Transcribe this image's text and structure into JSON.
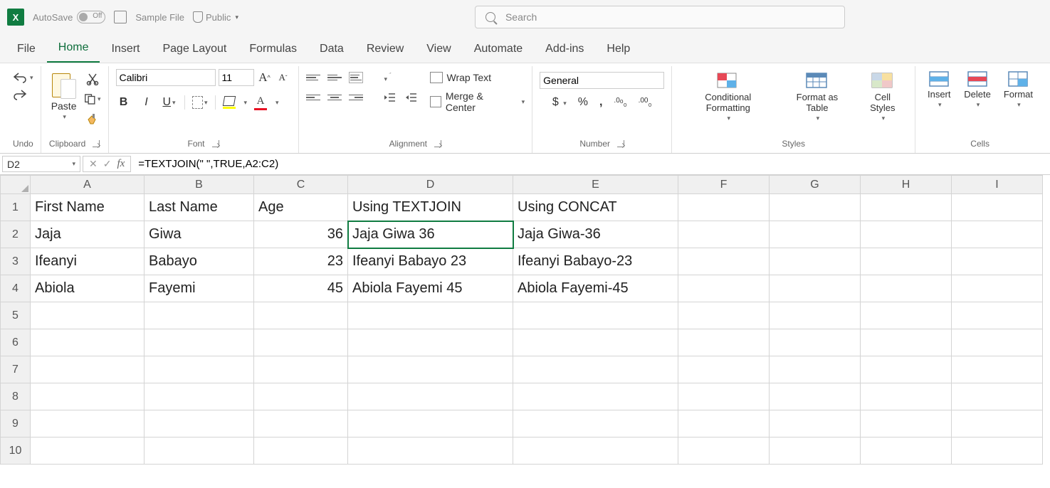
{
  "titlebar": {
    "autosave_label": "AutoSave",
    "autosave_state": "Off",
    "filename": "Sample File",
    "visibility": "Public",
    "search_placeholder": "Search"
  },
  "tabs": [
    "File",
    "Home",
    "Insert",
    "Page Layout",
    "Formulas",
    "Data",
    "Review",
    "View",
    "Automate",
    "Add-ins",
    "Help"
  ],
  "active_tab": "Home",
  "ribbon": {
    "undo_label": "Undo",
    "clipboard": {
      "paste": "Paste",
      "label": "Clipboard"
    },
    "font": {
      "name": "Calibri",
      "size": "11",
      "label": "Font"
    },
    "alignment": {
      "wrap": "Wrap Text",
      "merge": "Merge & Center",
      "label": "Alignment"
    },
    "number": {
      "format": "General",
      "label": "Number"
    },
    "styles": {
      "cond": "Conditional Formatting",
      "table": "Format as Table",
      "cell": "Cell Styles",
      "label": "Styles"
    },
    "cells": {
      "insert": "Insert",
      "delete": "Delete",
      "format": "Format",
      "label": "Cells"
    }
  },
  "formula_bar": {
    "namebox": "D2",
    "formula": "=TEXTJOIN(\" \",TRUE,A2:C2)"
  },
  "columns": [
    "A",
    "B",
    "C",
    "D",
    "E",
    "F",
    "G",
    "H",
    "I"
  ],
  "rows": [
    "1",
    "2",
    "3",
    "4",
    "5",
    "6",
    "7",
    "8",
    "9",
    "10"
  ],
  "sheet": {
    "r1": {
      "A": "First Name",
      "B": "Last Name",
      "C": "Age",
      "D": "Using TEXTJOIN",
      "E": "Using CONCAT"
    },
    "r2": {
      "A": "Jaja",
      "B": "Giwa",
      "C": "36",
      "D": "Jaja Giwa 36",
      "E": "Jaja Giwa-36"
    },
    "r3": {
      "A": "Ifeanyi",
      "B": "Babayo",
      "C": "23",
      "D": "Ifeanyi Babayo 23",
      "E": "Ifeanyi Babayo-23"
    },
    "r4": {
      "A": "Abiola",
      "B": "Fayemi",
      "C": "45",
      "D": "Abiola Fayemi 45",
      "E": "Abiola Fayemi-45"
    }
  },
  "selected_cell": "D2"
}
